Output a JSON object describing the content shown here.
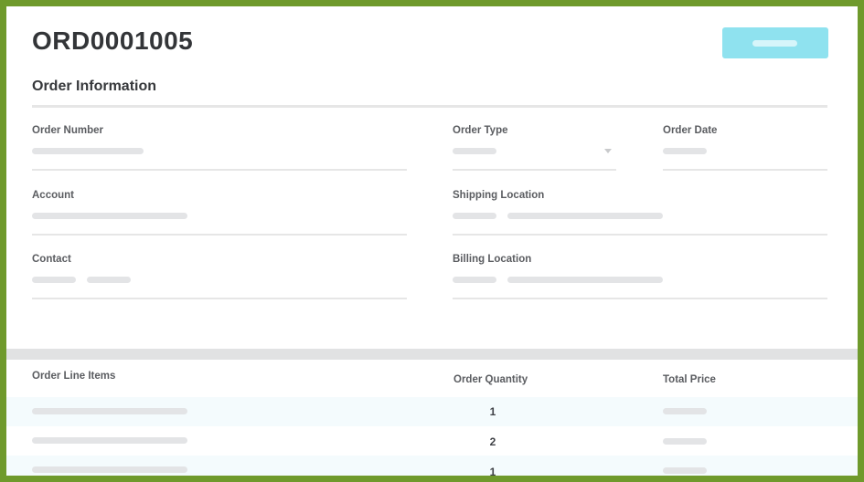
{
  "order": {
    "title": "ORD0001005",
    "section_title": "Order Information"
  },
  "fields": {
    "order_number_label": "Order Number",
    "order_type_label": "Order Type",
    "order_date_label": "Order Date",
    "account_label": "Account",
    "shipping_location_label": "Shipping Location",
    "contact_label": "Contact",
    "billing_location_label": "Billing Location"
  },
  "line_items": {
    "headers": {
      "item": "Order Line Items",
      "quantity": "Order Quantity",
      "total": "Total Price"
    },
    "rows": [
      {
        "quantity": "1"
      },
      {
        "quantity": "2"
      },
      {
        "quantity": "1"
      }
    ]
  },
  "colors": {
    "frame_border": "#6f9a2c",
    "primary_button": "#8fe2ef",
    "row_highlight": "#f4fbfd"
  }
}
